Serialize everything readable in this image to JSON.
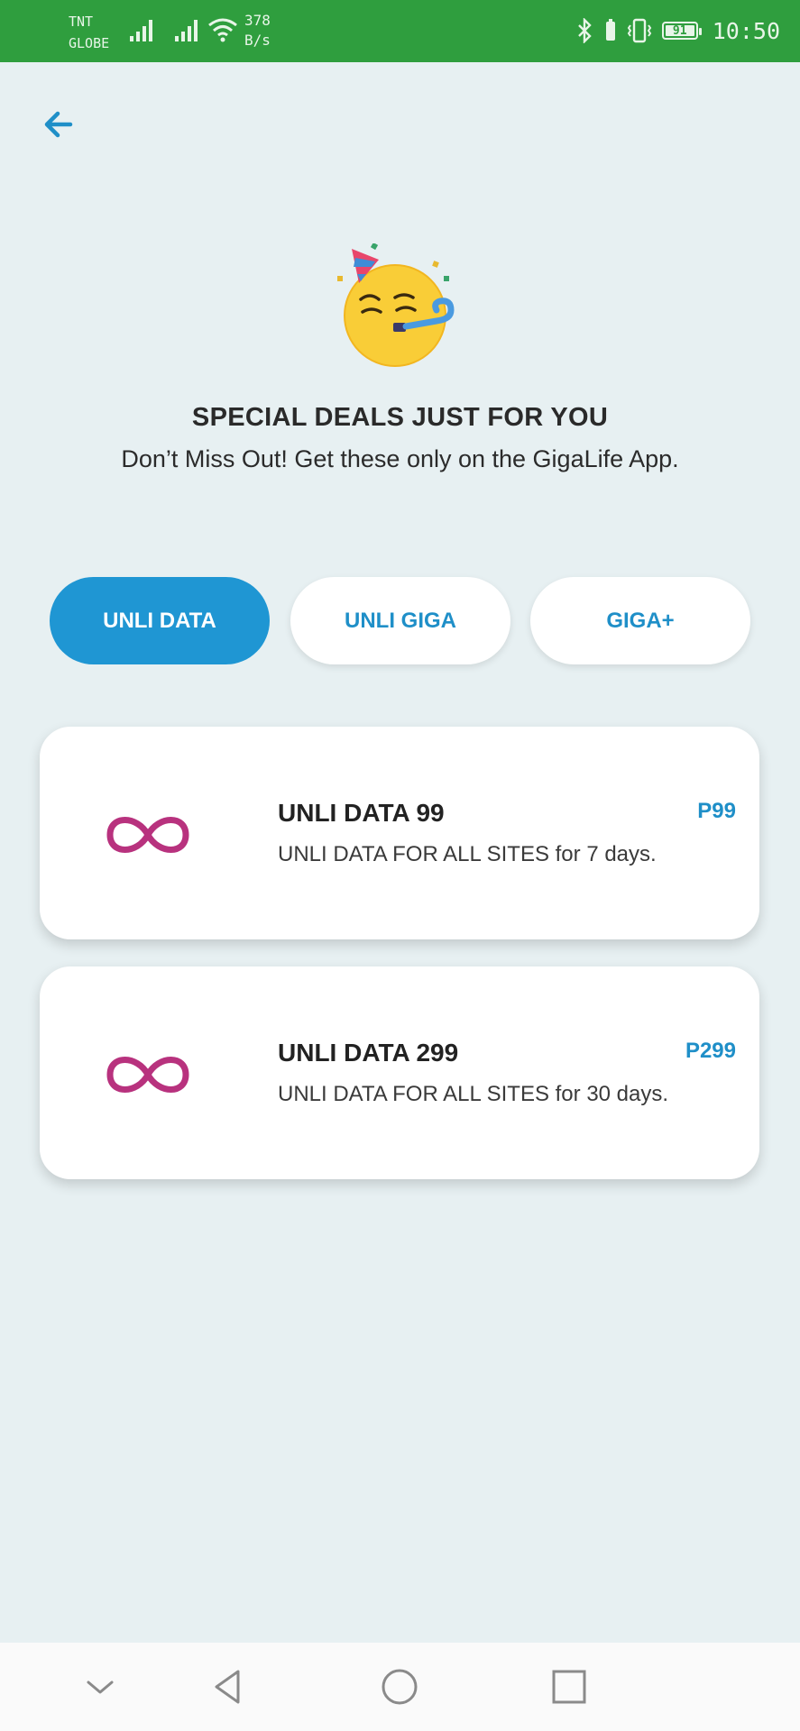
{
  "status_bar": {
    "carrier_top": "TNT",
    "carrier_bottom": "GLOBE",
    "speed_value": "378",
    "speed_unit": "B/s",
    "battery": "91",
    "time": "10:50",
    "color": "#2f9e3e"
  },
  "header": {
    "back_icon": "back-arrow-icon",
    "title": "SPECIAL DEALS JUST FOR YOU",
    "subtitle": "Don’t Miss Out! Get these only on the GigaLife App."
  },
  "tabs": [
    {
      "label": "UNLI DATA",
      "active": true
    },
    {
      "label": "UNLI GIGA",
      "active": false
    },
    {
      "label": "GIGA+",
      "active": false
    }
  ],
  "deals": [
    {
      "name": "UNLI DATA 99",
      "description": "UNLI DATA FOR ALL SITES for 7 days.",
      "price": "P99",
      "icon": "infinity-icon"
    },
    {
      "name": "UNLI DATA 299",
      "description": "UNLI DATA FOR ALL SITES for 30 days.",
      "price": "P299",
      "icon": "infinity-icon"
    }
  ],
  "colors": {
    "accent": "#1f96d3",
    "infinity": "#b8327e",
    "background": "#e7f0f2"
  },
  "nav_bar": [
    "chevron-down-icon",
    "back-triangle-icon",
    "home-circle-icon",
    "recents-square-icon"
  ]
}
